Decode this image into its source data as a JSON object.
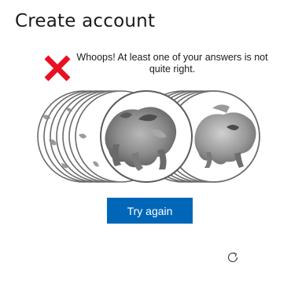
{
  "header": {
    "title": "Create account"
  },
  "challenge": {
    "error_message": "Whoops! At least one of your answers is not quite right.",
    "error_icon": "close-x-icon",
    "image_description_icon": "animal-photo-carousel",
    "try_again_label": "Try again",
    "refresh_icon": "refresh-icon"
  },
  "colors": {
    "error_red": "#e81123",
    "button_blue": "#0067b8",
    "ring_gray": "#6b6b6b"
  }
}
